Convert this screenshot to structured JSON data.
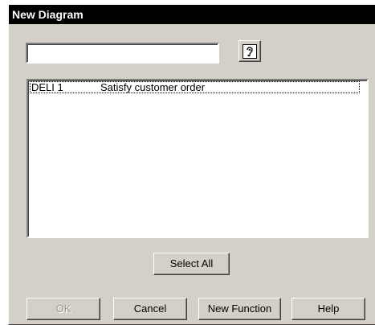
{
  "window": {
    "title": "New Diagram"
  },
  "search": {
    "value": "",
    "help_icon": "help-ear-icon"
  },
  "list": {
    "rows": [
      {
        "id": "DELI 1",
        "description": "Satisfy customer order"
      }
    ]
  },
  "buttons": {
    "select_all": "Select All",
    "ok": "OK",
    "cancel": "Cancel",
    "new_function": "New Function",
    "help": "Help"
  }
}
